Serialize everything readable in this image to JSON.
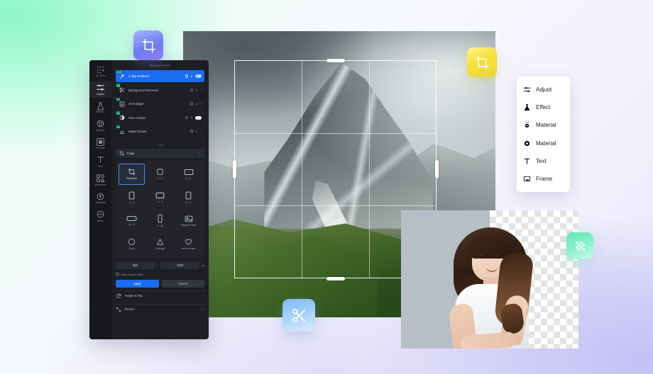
{
  "app": {
    "panel_header": "Popular Tools",
    "section_label": "Crop"
  },
  "rail": {
    "items": [
      {
        "label": "AI Tools",
        "icon": "sparkle-grid-icon",
        "active": false
      },
      {
        "label": "Adjust",
        "icon": "sliders-icon",
        "active": true
      },
      {
        "label": "Effects",
        "icon": "flask-icon",
        "active": false
      },
      {
        "label": "Beauty",
        "icon": "face-icon",
        "active": false
      },
      {
        "label": "Frames",
        "icon": "frame-icon",
        "active": false
      },
      {
        "label": "Text",
        "icon": "text-t-icon",
        "active": false
      },
      {
        "label": "Elements",
        "icon": "elements-icon",
        "active": false
      },
      {
        "label": "Uploads",
        "icon": "upload-cloud-icon",
        "active": false
      },
      {
        "label": "More",
        "icon": "more-circle-icon",
        "active": false
      }
    ]
  },
  "tools": [
    {
      "name": "1-Tap Enhance",
      "badge": "HD",
      "icon": "magic-wand-icon",
      "control": "toggle",
      "selected": true
    },
    {
      "name": "Background Remover",
      "badge": "AI",
      "icon": "scissors-icon",
      "control": "chevron",
      "selected": false
    },
    {
      "name": "AI Enlarger",
      "badge": "AI",
      "icon": "enlarge-icon",
      "control": "chevron",
      "selected": false
    },
    {
      "name": "Face Unblur",
      "badge": "AI",
      "icon": "contrast-icon",
      "control": "toggle",
      "selected": false
    },
    {
      "name": "Magic Eraser",
      "badge": "AI",
      "icon": "eraser-icon",
      "control": "chevron",
      "selected": false
    }
  ],
  "crop": {
    "dropdown_value": "Crop",
    "dropdown_icon": "crop-icon",
    "chevron_icon": "chevron-down-icon",
    "ratios": [
      {
        "label": "Freeform",
        "shape": "freeform",
        "selected": true
      },
      {
        "label": "1 : 1",
        "shape": "square",
        "selected": false
      },
      {
        "label": "3 : 2",
        "shape": "landscape",
        "selected": false
      },
      {
        "label": "2 : 3",
        "shape": "portrait",
        "selected": false
      },
      {
        "label": "4 : 3",
        "shape": "landscape-wide",
        "selected": false
      },
      {
        "label": "3 : 4",
        "shape": "portrait-tall",
        "selected": false
      },
      {
        "label": "16 : 9",
        "shape": "wide",
        "selected": false
      },
      {
        "label": "9 : 16",
        "shape": "tall",
        "selected": false
      },
      {
        "label": "Original Ratio",
        "shape": "image",
        "selected": false
      },
      {
        "label": "Circle",
        "shape": "circle",
        "selected": false
      },
      {
        "label": "Triangle",
        "shape": "triangle",
        "selected": false
      },
      {
        "label": "Heart-shape",
        "shape": "heart",
        "selected": false
      }
    ],
    "width": "800",
    "height": "1000",
    "multiply_symbol": "×",
    "unit": "px",
    "keep_aspect_label": "Keep Aspect Ratio",
    "apply_label": "Apply",
    "cancel_label": "Cancel"
  },
  "footer_rows": [
    {
      "label": "Rotate & Flip",
      "icon": "rotate-icon",
      "chevron": "›"
    },
    {
      "label": "Resize",
      "icon": "resize-icon",
      "chevron": "›"
    }
  ],
  "float_menu": {
    "items": [
      {
        "label": "Adjust",
        "icon": "sliders-icon"
      },
      {
        "label": "Effect",
        "icon": "flask-icon"
      },
      {
        "label": "Material",
        "icon": "sparkle-circle-icon"
      },
      {
        "label": "Material",
        "icon": "ring-icon"
      },
      {
        "label": "Text",
        "icon": "text-t-icon"
      },
      {
        "label": "Frame",
        "icon": "frame-icon"
      }
    ]
  },
  "badges": [
    {
      "name": "crop-badge-purple",
      "icon": "crop-icon",
      "color": "#6d7cf0"
    },
    {
      "name": "crop-badge-yellow",
      "icon": "crop-icon",
      "color": "#f6e03c"
    },
    {
      "name": "scissors-badge-blue",
      "icon": "scissors-icon",
      "color": "#7fb8f5"
    },
    {
      "name": "transparency-badge-green",
      "icon": "checkerboard-icon",
      "color": "#5fe8b4"
    }
  ],
  "canvas": {
    "main_photo_alt": "Mountain landscape photo",
    "portrait_photo_alt": "Portrait of a woman with background removed"
  }
}
